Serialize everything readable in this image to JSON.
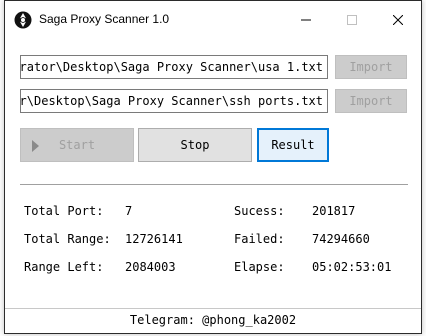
{
  "window": {
    "title": "Saga Proxy Scanner 1.0",
    "icon": "saga-logo-icon",
    "controls": [
      "minimize-icon",
      "maximize-icon",
      "close-icon"
    ]
  },
  "inputs": {
    "proxy_list_path": "trator\\Desktop\\Saga Proxy Scanner\\usa 1.txt",
    "ports_path": "or\\Desktop\\Saga Proxy Scanner\\ssh ports.txt",
    "import_label_1": "Import",
    "import_label_2": "Import"
  },
  "actions": {
    "start_label": "Start",
    "stop_label": "Stop",
    "result_label": "Result"
  },
  "stats": {
    "total_port_label": "Total Port:",
    "total_port_value": "7",
    "total_range_label": "Total Range:",
    "total_range_value": "12726141",
    "range_left_label": "Range Left:",
    "range_left_value": "2084003",
    "success_label": "Sucess:",
    "success_value": "201817",
    "failed_label": "Failed:",
    "failed_value": "74294660",
    "elapse_label": "Elapse:",
    "elapse_value": "05:02:53:01"
  },
  "footer": {
    "telegram": "Telegram: @phong_ka2002"
  },
  "colors": {
    "accent": "#0078d7",
    "disabled_bg": "#cccccc",
    "disabled_text": "#a0a0a0",
    "button_bg": "#e1e1e1"
  }
}
